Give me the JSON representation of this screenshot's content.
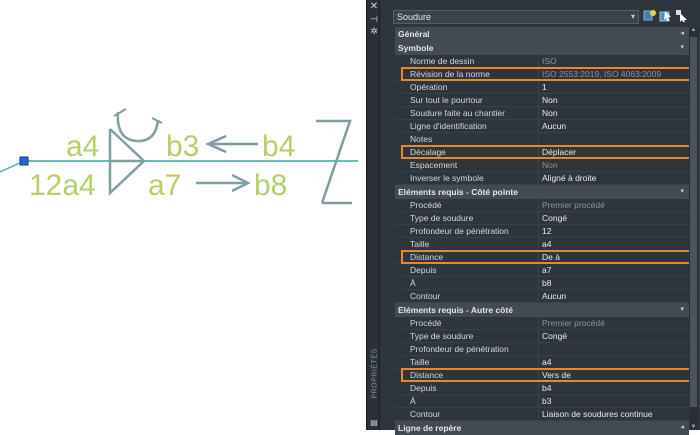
{
  "drawing": {
    "symbol_labels": [
      "a4",
      "b3",
      "b4",
      "12a4",
      "a7",
      "b8"
    ],
    "colors": {
      "text": "#b5cf6b",
      "leader": "#4fb3ad",
      "symbol": "#7f9ea2",
      "grip": "#2463c9"
    }
  },
  "sidebar": {
    "icons": [
      "close-icon",
      "pin-icon",
      "settings-icon"
    ],
    "vertical_label": "PROPRIÉTÉS"
  },
  "header": {
    "object_type": "Soudure",
    "toolbar_icons": [
      "quick-select-icon",
      "select-objects-icon",
      "toggle-pickadd-icon"
    ]
  },
  "sections": [
    {
      "title": "Général",
      "collapsed": true,
      "rows": []
    },
    {
      "title": "Symbole",
      "collapsed": false,
      "rows": [
        {
          "label": "Norme de dessin",
          "value": "ISO",
          "dim": true
        },
        {
          "label": "Révision de la norme",
          "value": "ISO 2553:2019, ISO 4063:2009",
          "dim": true,
          "highlight": true
        },
        {
          "label": "Opération",
          "value": "1"
        },
        {
          "label": "Sur tout le pourtour",
          "value": "Non"
        },
        {
          "label": "Soudure faite au chantier",
          "value": "Non"
        },
        {
          "label": "Ligne d'identification",
          "value": "Aucun"
        },
        {
          "label": "Notes",
          "value": ""
        },
        {
          "label": "Décalage",
          "value": "Déplacer",
          "highlight": true
        },
        {
          "label": "Espacement",
          "value": "Non",
          "dim": true
        },
        {
          "label": "Inverser le symbole",
          "value": "Aligné à droite"
        }
      ]
    },
    {
      "title": "Eléments requis - Côté pointe",
      "collapsed": false,
      "rows": [
        {
          "label": "Procédé",
          "value": "Premier procédé",
          "dim": true
        },
        {
          "label": "Type de soudure",
          "value": "Congé"
        },
        {
          "label": "Profondeur de pénétration",
          "value": "12"
        },
        {
          "label": "Taille",
          "value": "a4"
        },
        {
          "label": "Distance",
          "value": "De à",
          "highlight": true
        },
        {
          "label": "Depuis",
          "value": "a7"
        },
        {
          "label": "À",
          "value": "b8"
        },
        {
          "label": "Contour",
          "value": "Aucun"
        }
      ]
    },
    {
      "title": "Eléments requis - Autre côté",
      "collapsed": false,
      "rows": [
        {
          "label": "Procédé",
          "value": "Premier procédé",
          "dim": true
        },
        {
          "label": "Type de soudure",
          "value": "Congé"
        },
        {
          "label": "Profondeur de pénétration",
          "value": ""
        },
        {
          "label": "Taille",
          "value": "a4"
        },
        {
          "label": "Distance",
          "value": "Vers de",
          "highlight": true
        },
        {
          "label": "Depuis",
          "value": "b4"
        },
        {
          "label": "À",
          "value": "b3"
        },
        {
          "label": "Contour",
          "value": "Liaison de soudures continue"
        }
      ]
    },
    {
      "title": "Ligne de repère",
      "collapsed": true,
      "rows": []
    }
  ]
}
